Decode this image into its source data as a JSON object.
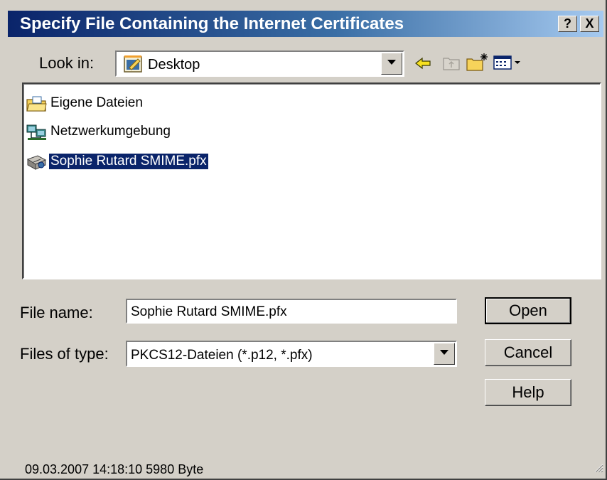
{
  "window": {
    "title": "Specify File Containing the Internet Certificates"
  },
  "titlebar_buttons": {
    "help": "?",
    "close": "X"
  },
  "lookin": {
    "label": "Look in:",
    "value": "Desktop",
    "icon": "desktop-folder-icon"
  },
  "toolbar": {
    "icons": [
      "back-arrow-icon",
      "up-folder-icon",
      "new-folder-icon",
      "view-menu-icon"
    ]
  },
  "files": [
    {
      "name": "Eigene Dateien",
      "icon": "my-documents-folder-icon",
      "selected": false
    },
    {
      "name": "Netzwerkumgebung",
      "icon": "network-neighborhood-icon",
      "selected": false
    },
    {
      "name": "Sophie Rutard SMIME.pfx",
      "icon": "certificate-file-icon",
      "selected": true
    }
  ],
  "filename": {
    "label": "File name:",
    "value": "Sophie Rutard SMIME.pfx"
  },
  "filetype": {
    "label": "Files of type:",
    "value": "PKCS12-Dateien (*.p12, *.pfx)"
  },
  "buttons": {
    "open": "Open",
    "cancel": "Cancel",
    "help": "Help"
  },
  "status": "09.03.2007 14:18:10 5980 Byte",
  "colors": {
    "title_start": "#0a246a",
    "title_end": "#a6caf0",
    "selection": "#0a246a",
    "face": "#d4d0c8"
  }
}
